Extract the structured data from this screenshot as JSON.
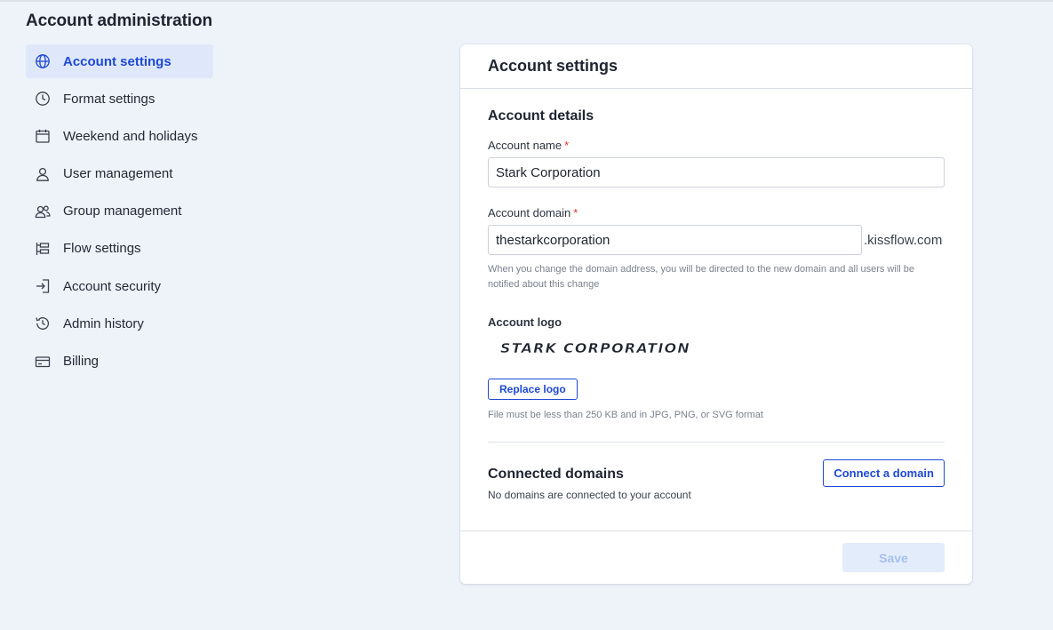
{
  "page": {
    "title": "Account administration"
  },
  "sidebar": {
    "items": [
      {
        "label": "Account settings",
        "icon": "globe-icon",
        "active": true
      },
      {
        "label": "Format settings",
        "icon": "clock-icon"
      },
      {
        "label": "Weekend and holidays",
        "icon": "calendar-icon"
      },
      {
        "label": "User management",
        "icon": "user-icon"
      },
      {
        "label": "Group management",
        "icon": "users-icon"
      },
      {
        "label": "Flow settings",
        "icon": "flow-icon"
      },
      {
        "label": "Account security",
        "icon": "login-icon"
      },
      {
        "label": "Admin history",
        "icon": "history-icon"
      },
      {
        "label": "Billing",
        "icon": "credit-card-icon"
      }
    ]
  },
  "card": {
    "header": "Account settings",
    "details_title": "Account details",
    "account_name": {
      "label": "Account name",
      "required": "*",
      "value": "Stark Corporation"
    },
    "account_domain": {
      "label": "Account domain",
      "required": "*",
      "value": "thestarkcorporation",
      "suffix": ".kissflow.com",
      "help": "When you change the domain address, you will be directed to the new domain and all users will be notified about this change"
    },
    "logo": {
      "label": "Account logo",
      "logo_text": "STARK CORPORATION",
      "replace_label": "Replace logo",
      "help": "File must be less than 250 KB and in JPG, PNG, or SVG format"
    },
    "connected_domains": {
      "title": "Connected domains",
      "empty_text": "No domains are connected to your account",
      "connect_label": "Connect a domain"
    },
    "save_label": "Save"
  },
  "colors": {
    "accent": "#1e49d6",
    "active_bg": "#dfe8fb",
    "save_disabled_bg": "#e3ecfb",
    "required": "#d9342b",
    "page_bg": "#eef2f9"
  }
}
